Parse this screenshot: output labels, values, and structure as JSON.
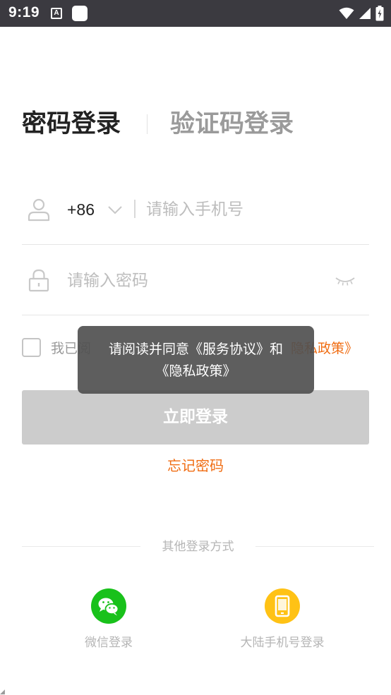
{
  "status_bar": {
    "time": "9:19",
    "icons": [
      "a-notification-icon",
      "app-notification-icon",
      "wifi-icon",
      "signal-icon",
      "battery-icon"
    ]
  },
  "tabs": {
    "password_login": "密码登录",
    "code_login": "验证码登录"
  },
  "phone": {
    "country_code": "+86",
    "placeholder": "请输入手机号",
    "value": ""
  },
  "password": {
    "placeholder": "请输入密码",
    "value": ""
  },
  "agreement": {
    "prefix": "我已阅",
    "link": "隐私政策》",
    "checked": false
  },
  "toast": {
    "line1": "请阅读并同意《服务协议》和",
    "line2": "《隐私政策》"
  },
  "login_button": "立即登录",
  "forgot_password": "忘记密码",
  "other_login": {
    "label": "其他登录方式",
    "wechat": "微信登录",
    "mainland_phone": "大陆手机号登录"
  },
  "colors": {
    "accent": "#f06d13",
    "status_bar": "#3b3a40",
    "button_disabled": "#cccccc",
    "wechat": "#19c11b",
    "mobile": "#ffc215"
  }
}
